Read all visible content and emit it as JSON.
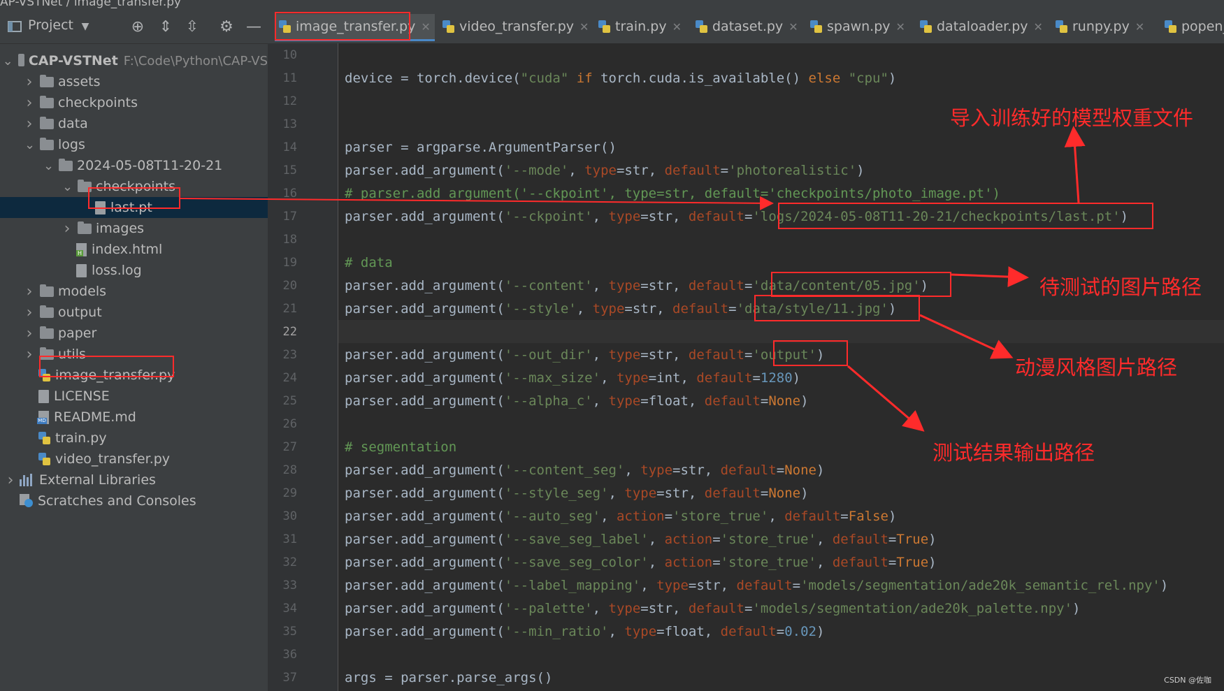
{
  "window": {
    "title_fragment": "AP-VSTNet / image_transfer.py"
  },
  "project": {
    "title": "Project",
    "tree": [
      {
        "label": "CAP-VSTNet",
        "path": "F:\\Code\\Python\\CAP-VS",
        "type": "folder",
        "depth": 0,
        "open": true
      },
      {
        "label": "assets",
        "type": "folder",
        "depth": 1,
        "open": false
      },
      {
        "label": "checkpoints",
        "type": "folder",
        "depth": 1,
        "open": false
      },
      {
        "label": "data",
        "type": "folder",
        "depth": 1,
        "open": false
      },
      {
        "label": "logs",
        "type": "folder",
        "depth": 1,
        "open": true
      },
      {
        "label": "2024-05-08T11-20-21",
        "type": "folder",
        "depth": 2,
        "open": true
      },
      {
        "label": "checkpoints",
        "type": "folder",
        "depth": 3,
        "open": true
      },
      {
        "label": "last.pt",
        "type": "file",
        "depth": 4,
        "selected": true
      },
      {
        "label": "images",
        "type": "folder",
        "depth": 3,
        "open": false
      },
      {
        "label": "index.html",
        "type": "html",
        "depth": 3
      },
      {
        "label": "loss.log",
        "type": "file",
        "depth": 3
      },
      {
        "label": "models",
        "type": "folder",
        "depth": 1,
        "open": false
      },
      {
        "label": "output",
        "type": "folder",
        "depth": 1,
        "open": false
      },
      {
        "label": "paper",
        "type": "folder",
        "depth": 1,
        "open": false
      },
      {
        "label": "utils",
        "type": "folder",
        "depth": 1,
        "open": false
      },
      {
        "label": "image_transfer.py",
        "type": "py",
        "depth": 1
      },
      {
        "label": "LICENSE",
        "type": "file",
        "depth": 1
      },
      {
        "label": "README.md",
        "type": "md",
        "depth": 1
      },
      {
        "label": "train.py",
        "type": "py",
        "depth": 1
      },
      {
        "label": "video_transfer.py",
        "type": "py",
        "depth": 1
      },
      {
        "label": "External Libraries",
        "type": "lib",
        "depth": 0,
        "open": false
      },
      {
        "label": "Scratches and Consoles",
        "type": "scratch",
        "depth": 0
      }
    ]
  },
  "tabs": [
    "image_transfer.py",
    "video_transfer.py",
    "train.py",
    "dataset.py",
    "spawn.py",
    "dataloader.py",
    "runpy.py",
    "popen_"
  ],
  "line_numbers": [
    "10",
    "11",
    "12",
    "13",
    "14",
    "15",
    "16",
    "17",
    "18",
    "19",
    "20",
    "21",
    "22",
    "23",
    "24",
    "25",
    "26",
    "27",
    "28",
    "29",
    "30",
    "31",
    "32",
    "33",
    "34",
    "35",
    "36",
    "37"
  ],
  "code": {
    "l11": [
      "device = torch.device(",
      "\"cuda\"",
      " if ",
      "torch.cuda.is_available() ",
      "else",
      " ",
      "\"cpu\"",
      ")"
    ],
    "l14": "parser = argparse.ArgumentParser()",
    "l15": [
      "parser.add_argument(",
      "'--mode'",
      ", ",
      "type",
      "=str, ",
      "default",
      "=",
      "'photorealistic'",
      ")"
    ],
    "l16": "# parser.add_argument('--ckpoint', type=str, default='checkpoints/photo_image.pt')",
    "l17": [
      "parser.add_argument(",
      "'--ckpoint'",
      ", ",
      "type",
      "=str, ",
      "default",
      "=",
      "'logs/2024-05-08T11-20-21/checkpoints/last.pt'",
      ")"
    ],
    "l19": "# data",
    "l20": [
      "parser.add_argument(",
      "'--content'",
      ", ",
      "type",
      "=str, ",
      "default",
      "=",
      "'data/content/05.jpg'",
      ")"
    ],
    "l21": [
      "parser.add_argument(",
      "'--style'",
      ", ",
      "type",
      "=str, ",
      "default",
      "=",
      "'data/style/11.jpg'",
      ")"
    ],
    "l23": [
      "parser.add_argument(",
      "'--out_dir'",
      ", ",
      "type",
      "=str, ",
      "default",
      "=",
      "'output'",
      ")"
    ],
    "l24": [
      "parser.add_argument(",
      "'--max_size'",
      ", ",
      "type",
      "=int, ",
      "default",
      "=",
      "1280",
      ")"
    ],
    "l25": [
      "parser.add_argument(",
      "'--alpha_c'",
      ", ",
      "type",
      "=float, ",
      "default",
      "=",
      "None",
      ")"
    ],
    "l27": "# segmentation",
    "l28": [
      "parser.add_argument(",
      "'--content_seg'",
      ", ",
      "type",
      "=str, ",
      "default",
      "=",
      "None",
      ")"
    ],
    "l29": [
      "parser.add_argument(",
      "'--style_seg'",
      ", ",
      "type",
      "=str, ",
      "default",
      "=",
      "None",
      ")"
    ],
    "l30": [
      "parser.add_argument(",
      "'--auto_seg'",
      ", ",
      "action",
      "=",
      "'store_true'",
      ", ",
      "default",
      "=",
      "False",
      ")"
    ],
    "l31": [
      "parser.add_argument(",
      "'--save_seg_label'",
      ", ",
      "action",
      "=",
      "'store_true'",
      ", ",
      "default",
      "=",
      "True",
      ")"
    ],
    "l32": [
      "parser.add_argument(",
      "'--save_seg_color'",
      ", ",
      "action",
      "=",
      "'store_true'",
      ", ",
      "default",
      "=",
      "True",
      ")"
    ],
    "l33": [
      "parser.add_argument(",
      "'--label_mapping'",
      ", ",
      "type",
      "=str, ",
      "default",
      "=",
      "'models/segmentation/ade20k_semantic_rel.npy'",
      ")"
    ],
    "l34": [
      "parser.add_argument(",
      "'--palette'",
      ", ",
      "type",
      "=str, ",
      "default",
      "=",
      "'models/segmentation/ade20k_palette.npy'",
      ")"
    ],
    "l35": [
      "parser.add_argument(",
      "'--min_ratio'",
      ", ",
      "type",
      "=float, ",
      "default",
      "=",
      "0.02",
      ")"
    ],
    "l37": "args = parser.parse_args()"
  },
  "annotations": {
    "weights": "导入训练好的模型权重文件",
    "content": "待测试的图片路径",
    "style": "动漫风格图片路径",
    "output": "测试结果输出路径"
  },
  "watermark": "CSDN @佐咖",
  "colors": {
    "annotation": "#ff2b2b",
    "keyword": "#cc7832",
    "string": "#6a8759",
    "param": "#aa4926",
    "number": "#6897bb",
    "comment": "#629755"
  }
}
